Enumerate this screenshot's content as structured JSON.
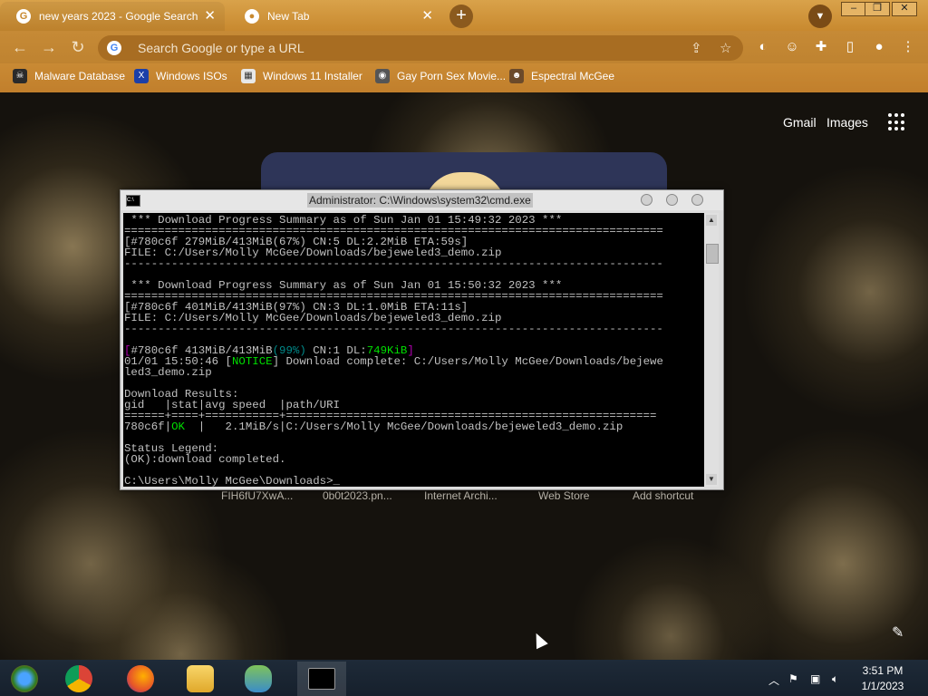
{
  "browser": {
    "tabs": [
      {
        "title": "new years 2023 - Google Search",
        "favicon": "google-icon"
      },
      {
        "title": "New Tab",
        "favicon": "chrome-icon"
      }
    ],
    "new_tab": "+",
    "omnibox_placeholder": "Search Google or type a URL",
    "bookmarks": [
      {
        "label": "Malware Database",
        "icon": "skull-icon"
      },
      {
        "label": "Windows ISOs",
        "icon": "x-icon"
      },
      {
        "label": "Windows 11 Installer",
        "icon": "installer-icon"
      },
      {
        "label": "Gay Porn Sex Movie...",
        "icon": "site-icon"
      },
      {
        "label": "Espectral McGee",
        "icon": "avatar-icon"
      }
    ],
    "accent": "#c8892f"
  },
  "ntp": {
    "links": [
      "Gmail",
      "Images"
    ],
    "shortcuts": [
      "FIH6fU7XwA...",
      "0b0t2023.pn...",
      "Internet Archi...",
      "Web Store",
      "Add shortcut"
    ]
  },
  "cmd": {
    "title": "Administrator: C:\\Windows\\system32\\cmd.exe",
    "lines": {
      "l1": " *** Download Progress Summary as of Sun Jan 01 15:49:32 2023 ***",
      "sep_eq": "================================================================================",
      "l3": "[#780c6f 279MiB/413MiB(67%) CN:5 DL:2.2MiB ETA:59s]",
      "l4": "FILE: C:/Users/Molly McGee/Downloads/bejeweled3_demo.zip",
      "sep_dash": "--------------------------------------------------------------------------------",
      "l7": " *** Download Progress Summary as of Sun Jan 01 15:50:32 2023 ***",
      "l9": "[#780c6f 401MiB/413MiB(97%) CN:3 DL:1.0MiB ETA:11s]",
      "l10": "FILE: C:/Users/Molly McGee/Downloads/bejeweled3_demo.zip",
      "l13a": "[",
      "l13b": "#780c6f 413MiB/413MiB",
      "l13c": "(99%)",
      "l13d": " CN:1 DL:",
      "l13e": "749KiB",
      "l13f": "]",
      "l14a": "01/01 15:50:46 [",
      "l14b": "NOTICE",
      "l14c": "] Download complete: C:/Users/Molly McGee/Downloads/bejewe",
      "l15": "led3_demo.zip",
      "l17": "Download Results:",
      "l18": "gid   |stat|avg speed  |path/URI",
      "l19": "======+====+===========+=======================================================",
      "l20a": "780c6f|",
      "l20b": "OK",
      "l20c": "  |   2.1MiB/s|C:/Users/Molly McGee/Downloads/bejeweled3_demo.zip",
      "l22": "Status Legend:",
      "l23": "(OK):download completed.",
      "l25": "C:\\Users\\Molly McGee\\Downloads>"
    }
  },
  "taskbar": {
    "apps": [
      "windows-start-icon",
      "chrome-icon",
      "firefox-icon",
      "file-explorer-icon",
      "network-people-icon",
      "cmd-icon"
    ],
    "time": "3:51 PM",
    "date": "1/1/2023"
  }
}
